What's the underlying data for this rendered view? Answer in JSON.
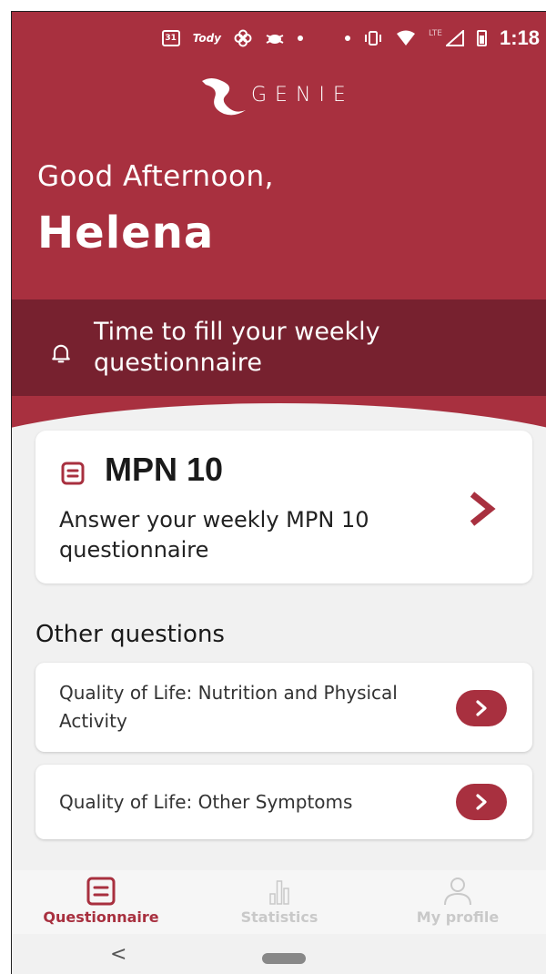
{
  "statusbar": {
    "calendar_day": "31",
    "carrier_text": "Tody",
    "network": "LTE",
    "time": "1:18"
  },
  "app": {
    "logo_text": "GENIE",
    "brand_color": "#a8303f",
    "notice_color": "#77212f"
  },
  "greeting": {
    "salutation": "Good Afternoon,",
    "name": "Helena"
  },
  "notice": {
    "icon": "bell-icon",
    "text": "Time to fill your weekly questionnaire"
  },
  "main_card": {
    "icon": "questionnaire-icon",
    "title": "MPN 10",
    "description": "Answer your weekly MPN 10 questionnaire",
    "arrow_icon": "chevron-right-icon"
  },
  "other_questions": {
    "title": "Other questions",
    "items": [
      {
        "label": "Quality of Life: Nutrition and Physical Activity",
        "icon": "chevron-right-icon"
      },
      {
        "label": "Quality of Life: Other Symptoms",
        "icon": "chevron-right-icon"
      }
    ]
  },
  "bottom_nav": {
    "items": [
      {
        "label": "Questionnaire",
        "icon": "questionnaire-icon",
        "active": true
      },
      {
        "label": "Statistics",
        "icon": "bar-chart-icon",
        "active": false
      },
      {
        "label": "My profile",
        "icon": "person-icon",
        "active": false
      }
    ]
  },
  "system_nav": {
    "back": "<"
  }
}
